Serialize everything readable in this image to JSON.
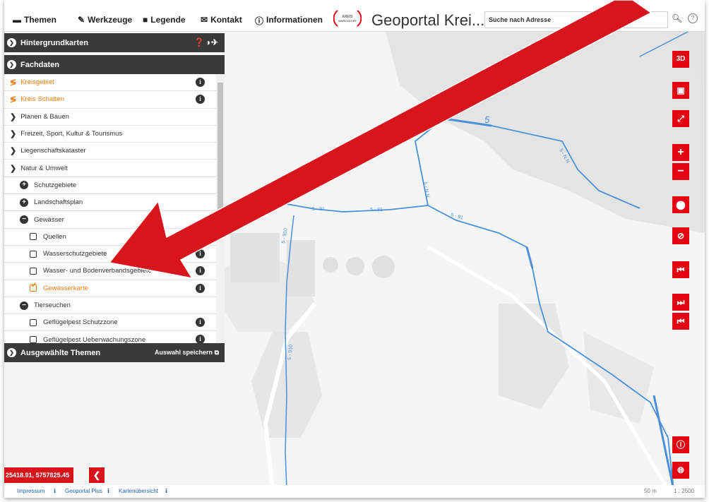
{
  "menu": {
    "themen": "Themen",
    "werkzeuge": "Werkzeuge",
    "legende": "Legende",
    "kontakt": "Kontakt",
    "informationen": "Informationen"
  },
  "logo": {
    "line1": "KREIS",
    "line2": "WARENDORF"
  },
  "site_title": "Geoportal Krei...",
  "search": {
    "placeholder": "Suche nach Adresse"
  },
  "panel": {
    "hintergrund": "Hintergrundkarten",
    "fachdaten": "Fachdaten",
    "rows": [
      {
        "label": "Kreisgebiet"
      },
      {
        "label": "Kreis Schatten"
      },
      {
        "label": "Planen & Bauen"
      },
      {
        "label": "Freizeit, Sport, Kultur & Tourismus"
      },
      {
        "label": "Liegenschaftskataster"
      },
      {
        "label": "Natur & Umwelt"
      },
      {
        "label": "Schutzgebiete"
      },
      {
        "label": "Landschaftsplan"
      },
      {
        "label": "Gewässer"
      },
      {
        "label": "Quellen"
      },
      {
        "label": "Wasserschutzgebiete"
      },
      {
        "label": "Wasser- und Bodenverbandsgebiete"
      },
      {
        "label": "Gewässerkarte"
      },
      {
        "label": "Tierseuchen"
      },
      {
        "label": "Geflügelpest Schutzzone"
      },
      {
        "label": "Geflügelpest Ueberwachungszone"
      }
    ],
    "footer": "Ausgewählte Themen",
    "save": "Auswahl speichern"
  },
  "map": {
    "labels": {
      "l1": "5",
      "l2": "5 - N N",
      "l3": "5 - 91",
      "l4": "5 - 91",
      "l5": "5 - 91",
      "l6": "5 - 91",
      "l7": "5 - N N",
      "l8": "5 - 910",
      "l9": "5 - 910"
    }
  },
  "toolbar": {
    "3d": "3D"
  },
  "coord": "25418.91, 5757825.45",
  "footer": {
    "impressum": "Impressum",
    "geoportal": "Geoportal Plus",
    "karten": "Kartenübersicht",
    "scale": "1 : 2500",
    "dist": "50 m"
  },
  "colors": {
    "accent": "#e30613",
    "orange": "#f07b12",
    "dark": "#3a3a3a",
    "water": "#4a90d9"
  }
}
